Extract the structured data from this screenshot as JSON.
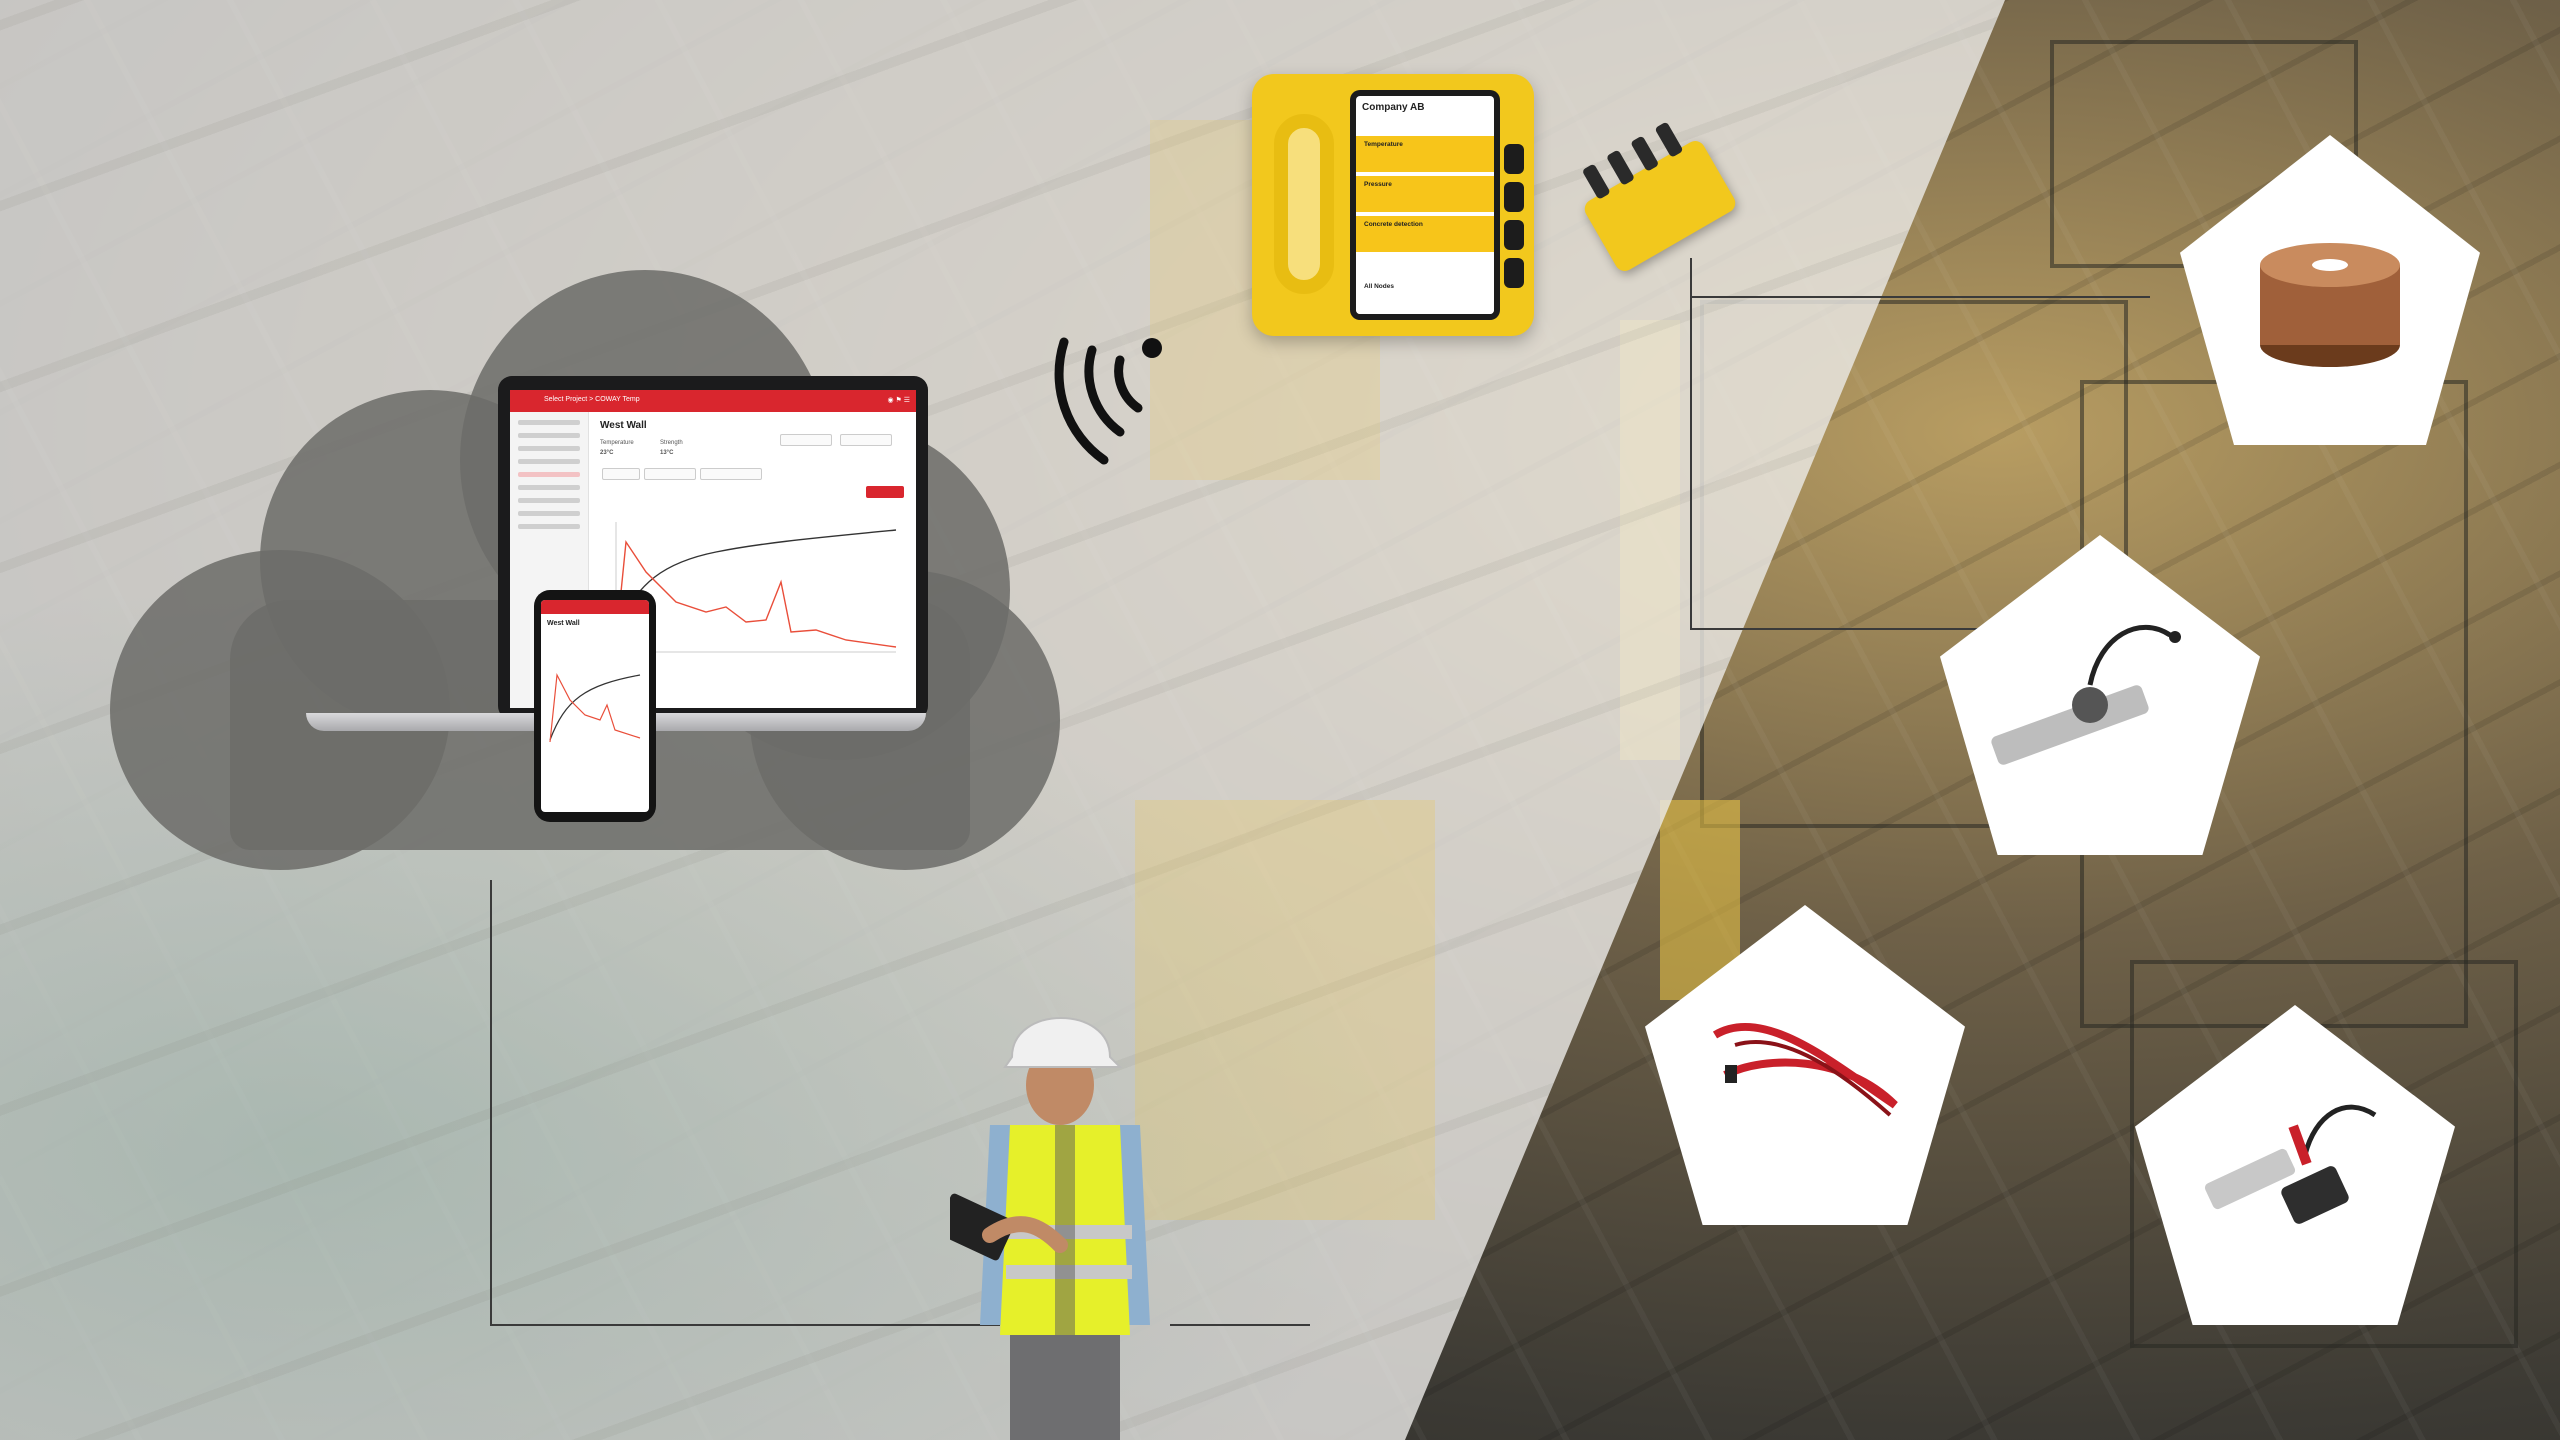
{
  "scene": {
    "description_text": ""
  },
  "laptop_app": {
    "breadcrumb": "Select Project  >  COWAY Temp",
    "page_title": "West Wall",
    "stat_1_label": "Temperature",
    "stat_1_value": "23°C",
    "stat_2_label": "Strength",
    "stat_2_value": "13°C"
  },
  "phone_app": {
    "page_title": "West Wall"
  },
  "device": {
    "company": "Company AB",
    "row_1": "Temperature",
    "row_2": "Pressure",
    "row_3": "Concrete detection",
    "footer": "All Nodes"
  },
  "colors": {
    "brand_red": "#d9262e",
    "device_yellow": "#f2c81d"
  }
}
